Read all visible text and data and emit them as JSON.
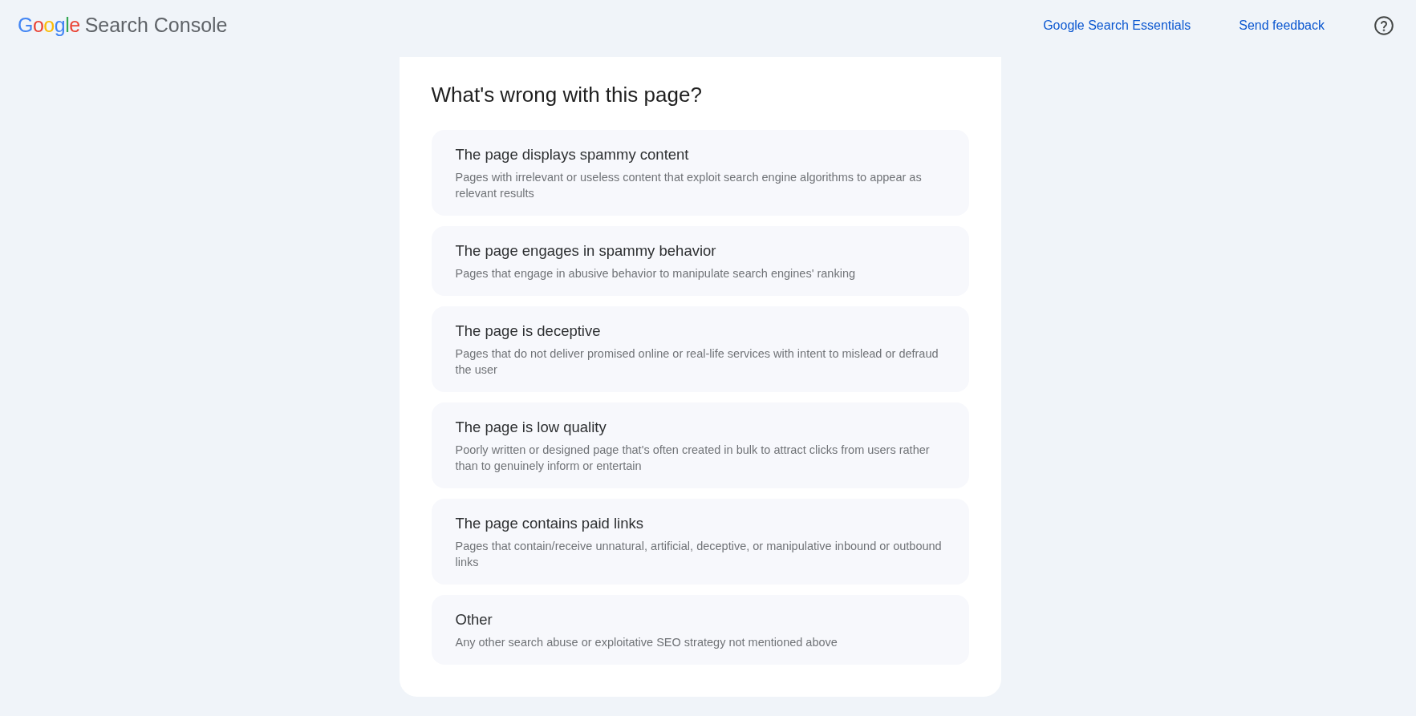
{
  "header": {
    "logo": {
      "brand": "Google",
      "product": "Search Console"
    },
    "links": [
      "Google Search Essentials",
      "Send feedback"
    ]
  },
  "panel": {
    "title": "What's wrong with this page?",
    "options": [
      {
        "title": "The page displays spammy content",
        "description": "Pages with irrelevant or useless content that exploit search engine algorithms to appear as relevant results"
      },
      {
        "title": "The page engages in spammy behavior",
        "description": "Pages that engage in abusive behavior to manipulate search engines' ranking"
      },
      {
        "title": "The page is deceptive",
        "description": "Pages that do not deliver promised online or real-life services with intent to mislead or defraud the user"
      },
      {
        "title": "The page is low quality",
        "description": "Poorly written or designed page that's often created in bulk to attract clicks from users rather than to genuinely inform or entertain"
      },
      {
        "title": "The page contains paid links",
        "description": "Pages that contain/receive unnatural, artificial, deceptive, or manipulative inbound or outbound links"
      },
      {
        "title": "Other",
        "description": "Any other search abuse or exploitative SEO strategy not mentioned above"
      }
    ]
  }
}
